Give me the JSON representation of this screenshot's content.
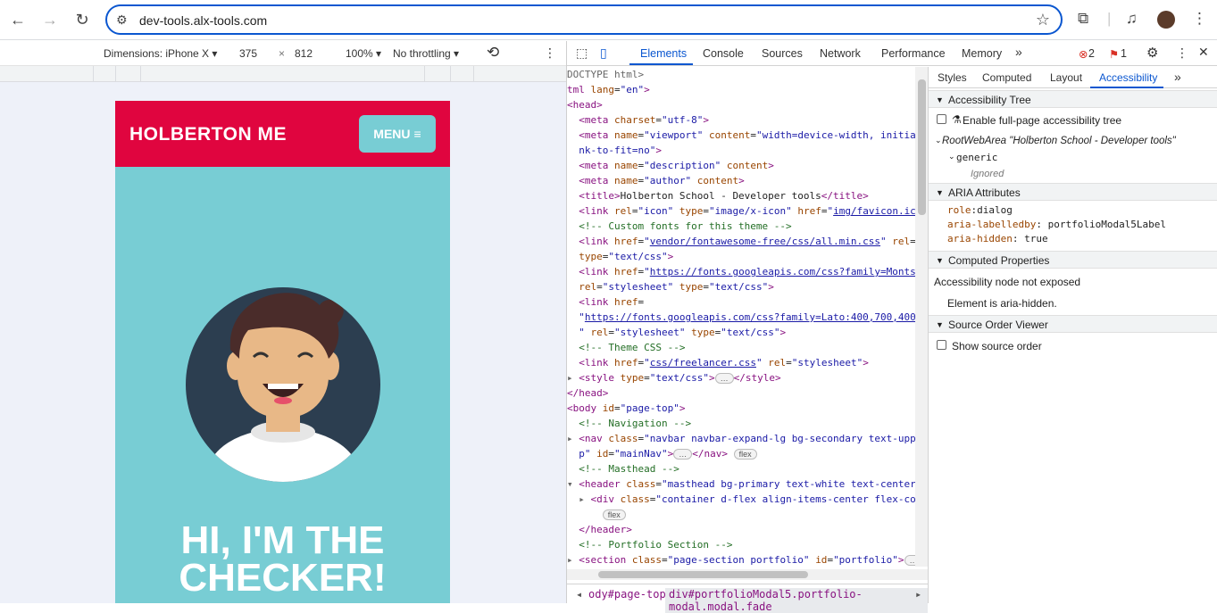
{
  "browser": {
    "url": "dev-tools.alx-tools.com"
  },
  "device_toolbar": {
    "dimensions_label": "Dimensions: iPhone X",
    "width": "375",
    "times": "×",
    "height": "812",
    "zoom": "100%",
    "throttling": "No throttling"
  },
  "page": {
    "brand": "HOLBERTON ME",
    "menu_label": "MENU",
    "headline_line1": "HI, I'M THE",
    "headline_line2": "CHECKER!"
  },
  "devtools": {
    "tabs": [
      "Elements",
      "Console",
      "Sources",
      "Network",
      "Performance",
      "Memory"
    ],
    "active_tab": "Elements",
    "errors_count": "2",
    "warnings_count": "1",
    "breadcrumbs": {
      "body": "ody#page-top",
      "div": "div#portfolioModal5.portfolio-modal.modal.fade"
    },
    "side_tabs": [
      "Styles",
      "Computed",
      "Layout",
      "Accessibility"
    ],
    "active_side_tab": "Accessibility",
    "accessibility": {
      "tree_header": "Accessibility Tree",
      "enable_full_page": "Enable full-page accessibility tree",
      "root_role": "RootWebArea",
      "root_name": "\"Holberton School - Developer tools\"",
      "generic": "generic",
      "ignored": "Ignored",
      "aria_header": "ARIA Attributes",
      "aria": [
        {
          "name": "role",
          "value": "dialog"
        },
        {
          "name": "aria-labelledby",
          "value": "portfolioModal5Label"
        },
        {
          "name": "aria-hidden",
          "value": "true"
        }
      ],
      "computed_header": "Computed Properties",
      "not_exposed": "Accessibility node not exposed",
      "aria_hidden_note": "Element is aria-hidden.",
      "source_order_header": "Source Order Viewer",
      "show_source_order": "Show source order"
    }
  },
  "colors": {
    "page_red": "#e0053f",
    "page_teal": "#78cdd4",
    "accent_blue": "#0b57d0"
  }
}
